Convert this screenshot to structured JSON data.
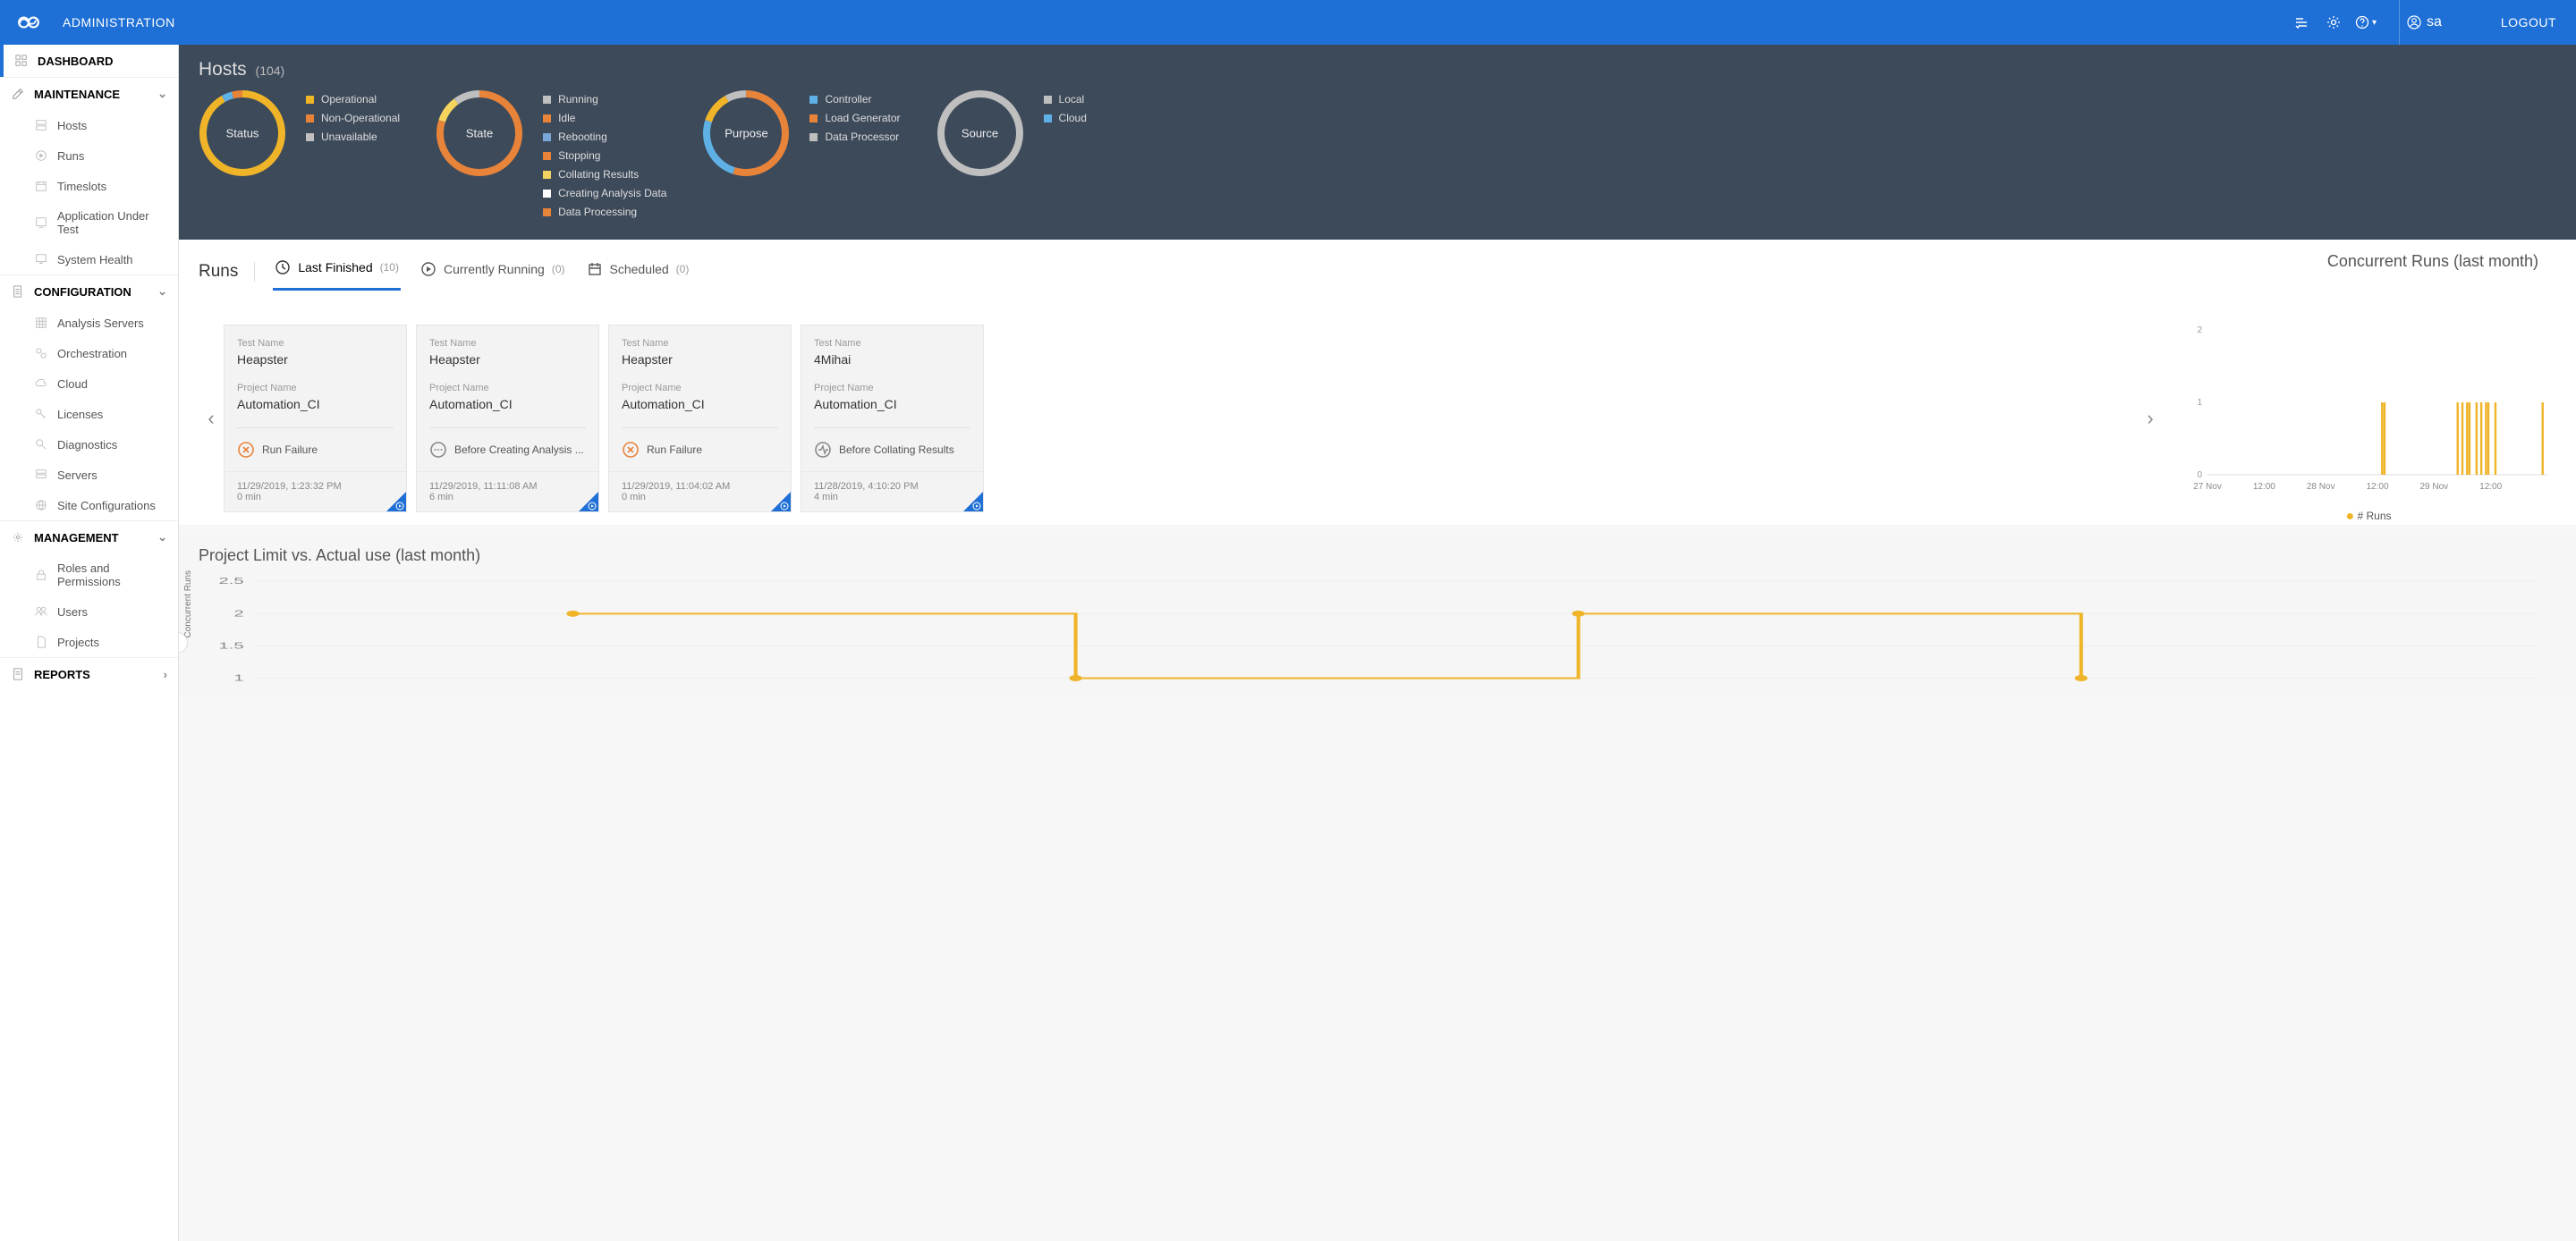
{
  "topbar": {
    "title": "ADMINISTRATION",
    "user": "sa",
    "logout": "LOGOUT"
  },
  "sidebar": {
    "dashboard": "DASHBOARD",
    "maintenance": {
      "label": "MAINTENANCE",
      "items": [
        "Hosts",
        "Runs",
        "Timeslots",
        "Application Under Test",
        "System Health"
      ]
    },
    "configuration": {
      "label": "CONFIGURATION",
      "items": [
        "Analysis Servers",
        "Orchestration",
        "Cloud",
        "Licenses",
        "Diagnostics",
        "Servers",
        "Site Configurations"
      ]
    },
    "management": {
      "label": "MANAGEMENT",
      "items": [
        "Roles and Permissions",
        "Users",
        "Projects"
      ]
    },
    "reports": {
      "label": "REPORTS"
    }
  },
  "hosts": {
    "title": "Hosts",
    "count": "(104)",
    "donuts": {
      "status": {
        "label": "Status",
        "legend": [
          {
            "c": "#f0b429",
            "t": "Operational"
          },
          {
            "c": "#e8833a",
            "t": "Non-Operational"
          },
          {
            "c": "#bfbfbf",
            "t": "Unavailable"
          }
        ]
      },
      "state": {
        "label": "State",
        "legend": [
          {
            "c": "#bfbfbf",
            "t": "Running"
          },
          {
            "c": "#e8833a",
            "t": "Idle"
          },
          {
            "c": "#7aa7d9",
            "t": "Rebooting"
          },
          {
            "c": "#e8833a",
            "t": "Stopping"
          },
          {
            "c": "#f4d35e",
            "t": "Collating Results"
          },
          {
            "c": "#ffffff",
            "t": "Creating Analysis Data"
          },
          {
            "c": "#e8833a",
            "t": "Data Processing"
          }
        ]
      },
      "purpose": {
        "label": "Purpose",
        "legend": [
          {
            "c": "#5fb0e5",
            "t": "Controller"
          },
          {
            "c": "#e8833a",
            "t": "Load Generator"
          },
          {
            "c": "#bfbfbf",
            "t": "Data Processor"
          }
        ]
      },
      "source": {
        "label": "Source",
        "legend": [
          {
            "c": "#bfbfbf",
            "t": "Local"
          },
          {
            "c": "#5fb0e5",
            "t": "Cloud"
          }
        ]
      }
    }
  },
  "runs": {
    "title": "Runs",
    "tabs": {
      "last_finished": {
        "label": "Last Finished",
        "count": "(10)"
      },
      "currently_running": {
        "label": "Currently Running",
        "count": "(0)"
      },
      "scheduled": {
        "label": "Scheduled",
        "count": "(0)"
      }
    },
    "labels": {
      "test_name": "Test Name",
      "project_name": "Project Name"
    },
    "cards": [
      {
        "test": "Heapster",
        "project": "Automation_CI",
        "status": "Run Failure",
        "status_type": "fail",
        "time": "11/29/2019, 1:23:32 PM",
        "dur": "0 min"
      },
      {
        "test": "Heapster",
        "project": "Automation_CI",
        "status": "Before Creating Analysis ...",
        "status_type": "pending",
        "time": "11/29/2019, 11:11:08 AM",
        "dur": "6 min"
      },
      {
        "test": "Heapster",
        "project": "Automation_CI",
        "status": "Run Failure",
        "status_type": "fail",
        "time": "11/29/2019, 11:04:02 AM",
        "dur": "0 min"
      },
      {
        "test": "4Mihai",
        "project": "Automation_CI",
        "status": "Before Collating Results",
        "status_type": "pending-alt",
        "time": "11/28/2019, 4:10:20 PM",
        "dur": "4 min"
      }
    ]
  },
  "concurrent": {
    "title": "Concurrent Runs (last month)",
    "legend": "# Runs"
  },
  "project_limit": {
    "title": "Project Limit vs. Actual use (last month)",
    "ylabel": "Concurrent Runs",
    "yticks": [
      "2.5",
      "2",
      "1.5",
      "1"
    ]
  },
  "colors": {
    "accent": "#1e6fd6",
    "dark": "#3d4a5a",
    "yellow": "#f0b429",
    "orange": "#e8833a"
  },
  "chart_data": [
    {
      "type": "bar",
      "title": "Concurrent Runs (last month)",
      "xlabel": "",
      "ylabel": "# Runs",
      "ylim": [
        0,
        2
      ],
      "x_tick_labels": [
        "27 Nov",
        "12:00",
        "28 Nov",
        "12:00",
        "29 Nov",
        "12:00"
      ],
      "series": [
        {
          "name": "# Runs",
          "points": [
            {
              "x": "2019-11-28T13:00",
              "y": 1
            },
            {
              "x": "2019-11-28T13:30",
              "y": 1
            },
            {
              "x": "2019-11-29T05:00",
              "y": 1
            },
            {
              "x": "2019-11-29T06:00",
              "y": 1
            },
            {
              "x": "2019-11-29T07:00",
              "y": 1
            },
            {
              "x": "2019-11-29T07:30",
              "y": 1
            },
            {
              "x": "2019-11-29T09:00",
              "y": 1
            },
            {
              "x": "2019-11-29T10:00",
              "y": 1
            },
            {
              "x": "2019-11-29T11:00",
              "y": 1
            },
            {
              "x": "2019-11-29T11:30",
              "y": 1
            },
            {
              "x": "2019-11-29T13:00",
              "y": 1
            },
            {
              "x": "2019-11-29T23:00",
              "y": 1
            }
          ]
        }
      ]
    },
    {
      "type": "line",
      "title": "Project Limit vs. Actual use (last month)",
      "ylabel": "Concurrent Runs",
      "ylim": [
        0.5,
        2.5
      ],
      "x_domain_hours": 72,
      "series": [
        {
          "name": "Project Limit",
          "points": [
            {
              "h": 14,
              "y": 2
            },
            {
              "h": 36,
              "y": 2
            },
            {
              "h": 36,
              "y": 1
            },
            {
              "h": 58,
              "y": 1
            },
            {
              "h": 58,
              "y": 2
            },
            {
              "h": 80,
              "y": 2
            },
            {
              "h": 80,
              "y": 1
            }
          ]
        }
      ]
    }
  ]
}
